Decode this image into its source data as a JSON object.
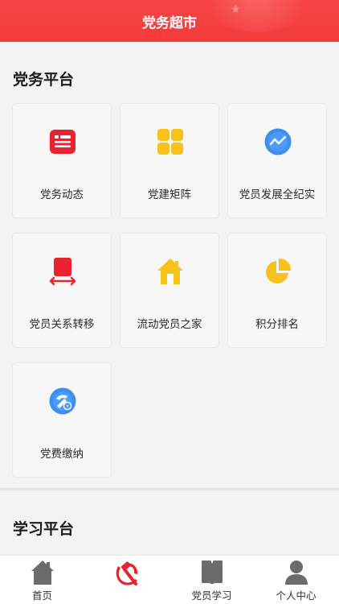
{
  "header": {
    "title": "党务超市"
  },
  "party_platform": {
    "title": "党务平台",
    "items": [
      {
        "label": "党务动态",
        "icon": "news-list-icon",
        "color": "#e8222e"
      },
      {
        "label": "党建矩阵",
        "icon": "grid-icon",
        "color": "#f7c31a"
      },
      {
        "label": "党员发展全纪实",
        "icon": "trend-chart-icon",
        "color": "#3e8ef2"
      },
      {
        "label": "党员关系转移",
        "icon": "transfer-icon",
        "color": "#e8222e"
      },
      {
        "label": "流动党员之家",
        "icon": "home-icon",
        "color": "#f7c31a"
      },
      {
        "label": "积分排名",
        "icon": "pie-chart-icon",
        "color": "#f7c31a"
      },
      {
        "label": "党费缴纳",
        "icon": "payment-globe-icon",
        "color": "#3e8ef2"
      }
    ]
  },
  "study_platform": {
    "title": "学习平台"
  },
  "tabbar": {
    "items": [
      {
        "label": "首页",
        "icon": "home-icon"
      },
      {
        "label": "",
        "icon": "party-emblem-icon"
      },
      {
        "label": "党员学习",
        "icon": "book-icon"
      },
      {
        "label": "个人中心",
        "icon": "user-icon"
      }
    ]
  },
  "colors": {
    "brand_red": "#f33c3c",
    "tab_icon_gray": "#6b6b6b"
  }
}
